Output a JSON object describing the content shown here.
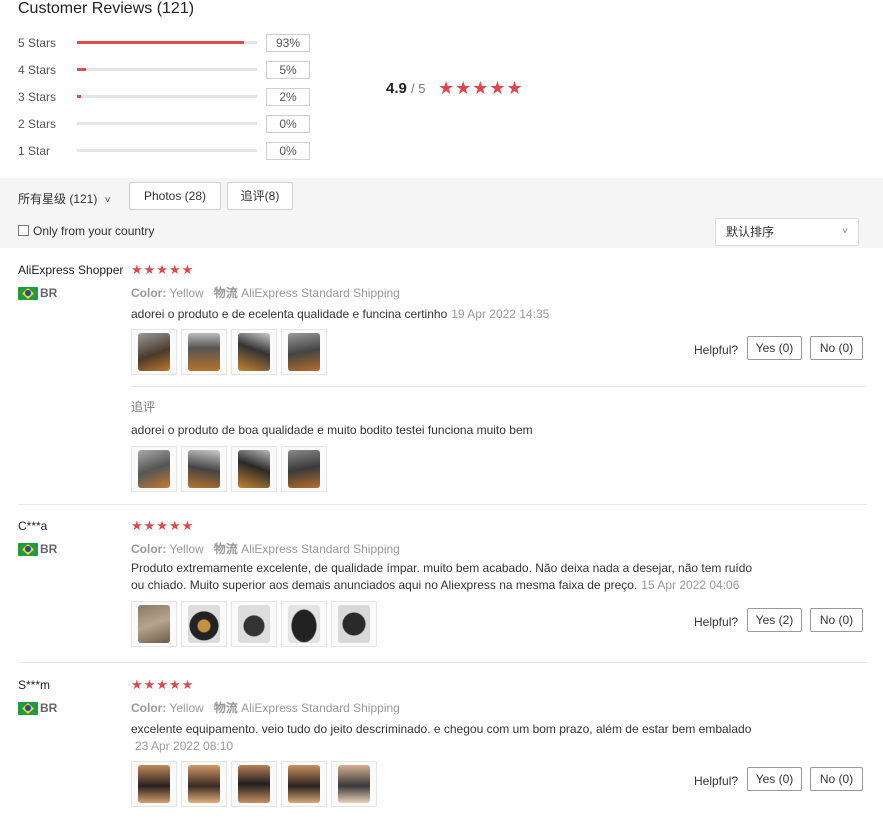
{
  "title": "Customer Reviews (121)",
  "distribution": [
    {
      "label": "5 Stars",
      "pct_text": "93%",
      "fill": 0.93
    },
    {
      "label": "4 Stars",
      "pct_text": "5%",
      "fill": 0.05
    },
    {
      "label": "3 Stars",
      "pct_text": "2%",
      "fill": 0.02
    },
    {
      "label": "2 Stars",
      "pct_text": "0%",
      "fill": 0
    },
    {
      "label": "1 Star",
      "pct_text": "0%",
      "fill": 0
    }
  ],
  "rating": {
    "score": "4.9",
    "out_of": "/ 5",
    "stars": "★★★★★"
  },
  "filters": {
    "all": "所有星级 (121)",
    "all_chevron": "˅",
    "photos": "Photos (28)",
    "followup": "追评(8)",
    "country": "Only from your country",
    "sort": "默认排序",
    "sort_chevron": "˅"
  },
  "reviews": [
    {
      "name": "AliExpress Shopper",
      "country": "BR",
      "stars": "★★★★★",
      "color_label": "Color:",
      "color": "Yellow",
      "shipping_label": "物流",
      "shipping": "AliExpress Standard Shipping",
      "text": "adorei o produto e de ecelenta qualidade e funcina certinho",
      "date": "19 Apr 2022 14:35",
      "helpful": "Helpful?",
      "yes": "Yes (0)",
      "no": "No (0)",
      "followup_label": "追评",
      "followup_text": "adorei o produto de boa qualidade e muito bodito testei funciona muito bem"
    },
    {
      "name": "C***a",
      "country": "BR",
      "stars": "★★★★★",
      "color_label": "Color:",
      "color": "Yellow",
      "shipping_label": "物流",
      "shipping": "AliExpress Standard Shipping",
      "text_line1": "Produto extremamente excelente, de qualidade ímpar. muito bem acabado. Não deixa nada a desejar, não tem ruído",
      "text_line2": "ou chiado. Muito superior aos demais anunciados aqui no Aliexpress na mesma faixa de preço.",
      "date": "15 Apr 2022 04:06",
      "helpful": "Helpful?",
      "yes": "Yes (2)",
      "no": "No (0)"
    },
    {
      "name": "S***m",
      "country": "BR",
      "stars": "★★★★★",
      "color_label": "Color:",
      "color": "Yellow",
      "shipping_label": "物流",
      "shipping": "AliExpress Standard Shipping",
      "text": "excelente equipamento. veio tudo do jeito descriminado. e chegou com um bom prazo, além de estar bem embalado",
      "date": "23 Apr 2022 08:10",
      "helpful": "Helpful?",
      "yes": "Yes (0)",
      "no": "No (0)"
    }
  ],
  "colors": {
    "accent": "#e04b4b",
    "star": "#e0474c",
    "filter_bg": "#f5f5f5"
  }
}
